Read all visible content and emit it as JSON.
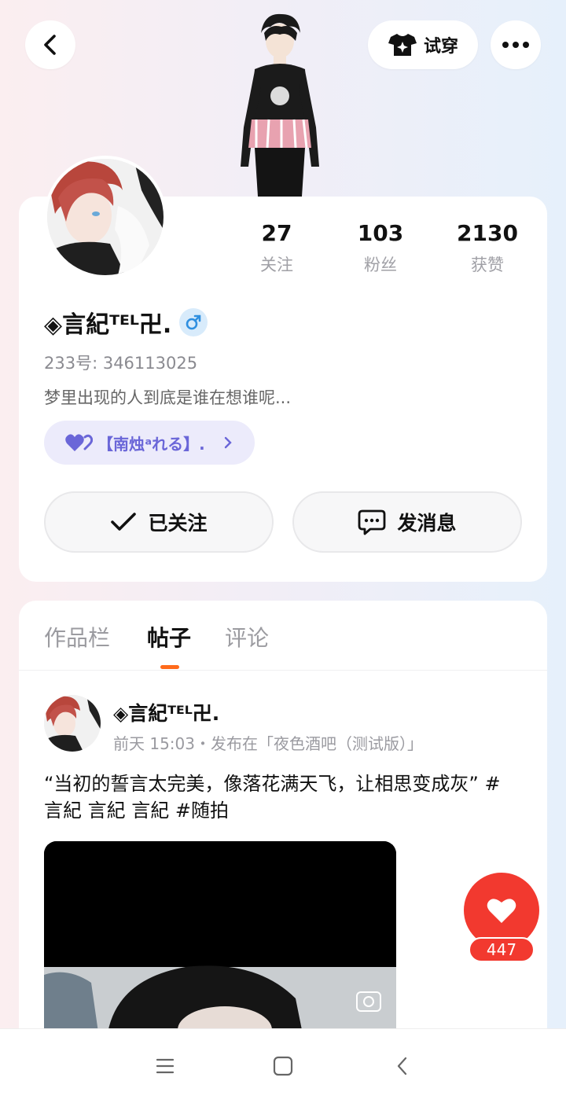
{
  "topbar": {
    "back_icon": "chevron-left-icon",
    "try_on_label": "试穿",
    "try_on_icon": "tshirt-sparkle-icon",
    "more_icon": "more-dots-icon"
  },
  "profile": {
    "name": "◈言紀ᵀᴱᴸ卍.",
    "gender_icon": "male-icon",
    "id_text": "233号: 346113025",
    "bio": "梦里出现的人到底是谁在想谁呢...",
    "tag_text": "【南烛ᵃれる】.",
    "stats": [
      {
        "value": "27",
        "label": "关注"
      },
      {
        "value": "103",
        "label": "粉丝"
      },
      {
        "value": "2130",
        "label": "获赞"
      }
    ],
    "follow_label": "已关注",
    "message_label": "发消息"
  },
  "tabs": [
    {
      "label": "作品栏",
      "active": false
    },
    {
      "label": "帖子",
      "active": true
    },
    {
      "label": "评论",
      "active": false
    }
  ],
  "post": {
    "author": "◈言紀ᵀᴱᴸ卍.",
    "meta": "前天 15:03・发布在「夜色酒吧（测试版）」",
    "text": "“当初的誓言太完美，像落花满天飞，让相思变成灰” #言紀 言紀 言紀 #随拍",
    "like_count": "447"
  },
  "colors": {
    "accent_orange": "#ff6a1a",
    "like_red": "#f2392f",
    "tag_purple": "#6a66d8"
  }
}
